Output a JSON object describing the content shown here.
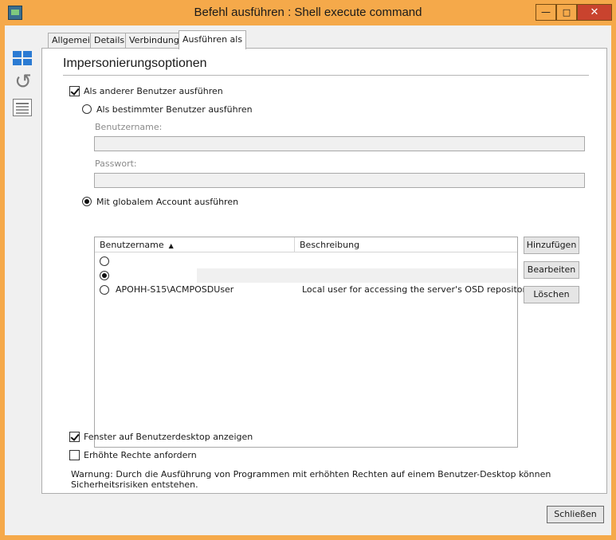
{
  "window": {
    "title": "Befehl ausführen : Shell execute command",
    "minimize_glyph": "—",
    "maximize_glyph": "□",
    "close_glyph": "✕"
  },
  "toolbar": {
    "icons": [
      "grid-icon",
      "refresh-icon",
      "document-icon"
    ],
    "refresh_glyph": "↺"
  },
  "tabs": [
    {
      "label": "Allgemein"
    },
    {
      "label": "Details"
    },
    {
      "label": "Verbindung"
    },
    {
      "label": "Ausführen als",
      "active": true
    }
  ],
  "section": {
    "title": "Impersonierungsoptionen"
  },
  "options": {
    "run_as_other": {
      "label": "Als anderer Benutzer ausführen",
      "checked": true
    },
    "specific_user": {
      "label": "Als bestimmter Benutzer ausführen",
      "checked": false
    },
    "username_label": "Benutzername:",
    "username_value": "",
    "password_label": "Passwort:",
    "password_value": "",
    "global_account": {
      "label": "Mit globalem Account ausführen",
      "checked": true
    }
  },
  "accounts_table": {
    "columns": [
      "Benutzername",
      "Beschreibung"
    ],
    "sort_glyph": "▲",
    "rows": [
      {
        "username": "",
        "description": "",
        "selected": false
      },
      {
        "username": "",
        "description": "",
        "selected": true
      },
      {
        "username": "APOHH-S15\\ACMPOSDUser",
        "description": "Local user for accessing the server's OSD repository",
        "selected": false
      }
    ]
  },
  "actions": {
    "add": "Hinzufügen",
    "edit": "Bearbeiten",
    "delete": "Löschen"
  },
  "bottom_options": {
    "show_window": {
      "label": "Fenster auf Benutzerdesktop anzeigen",
      "checked": true
    },
    "elevated": {
      "label": "Erhöhte Rechte anfordern",
      "checked": false
    }
  },
  "warning": "Warnung: Durch die Ausführung von Programmen mit erhöhten Rechten auf einem Benutzer-Desktop können Sicherheitsrisiken entstehen.",
  "footer": {
    "close": "Schließen"
  },
  "colors": {
    "titlebar": "#f5a94a",
    "close_button": "#c9432e",
    "accent_icon": "#2b7bd3"
  }
}
